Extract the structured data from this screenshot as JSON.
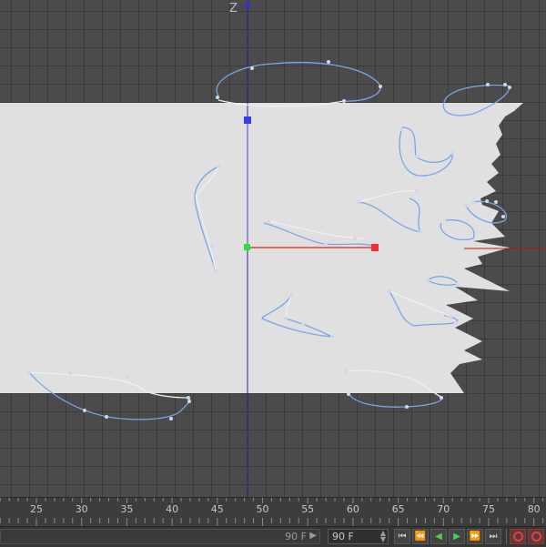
{
  "viewport": {
    "axis_label": "Z",
    "colors": {
      "grid": "#3b3b3b",
      "background": "#4b4b4b",
      "polygon": "#e0e0e0",
      "spline_blue": "#7aa6e8",
      "spline_white": "#ffffff",
      "axis_x": "#e02020",
      "axis_z": "#3030e0",
      "handle_center": "#30e030",
      "handle_x": "#f03030",
      "handle_z": "#3030f0"
    }
  },
  "timeline": {
    "ticks": [
      "25",
      "30",
      "35",
      "40",
      "45",
      "50",
      "55",
      "60",
      "65",
      "70",
      "75",
      "80"
    ]
  },
  "bottom_bar": {
    "end_frame_slider": "90 F",
    "end_frame_field": "90 F",
    "buttons": [
      {
        "name": "goto-start-button",
        "icon": "⏮"
      },
      {
        "name": "prev-key-button",
        "icon": "⏪"
      },
      {
        "name": "play-backward-button",
        "icon": "◀"
      },
      {
        "name": "play-forward-button",
        "icon": "▶"
      },
      {
        "name": "next-key-button",
        "icon": "⏩"
      },
      {
        "name": "goto-end-button",
        "icon": "⏭"
      }
    ]
  }
}
